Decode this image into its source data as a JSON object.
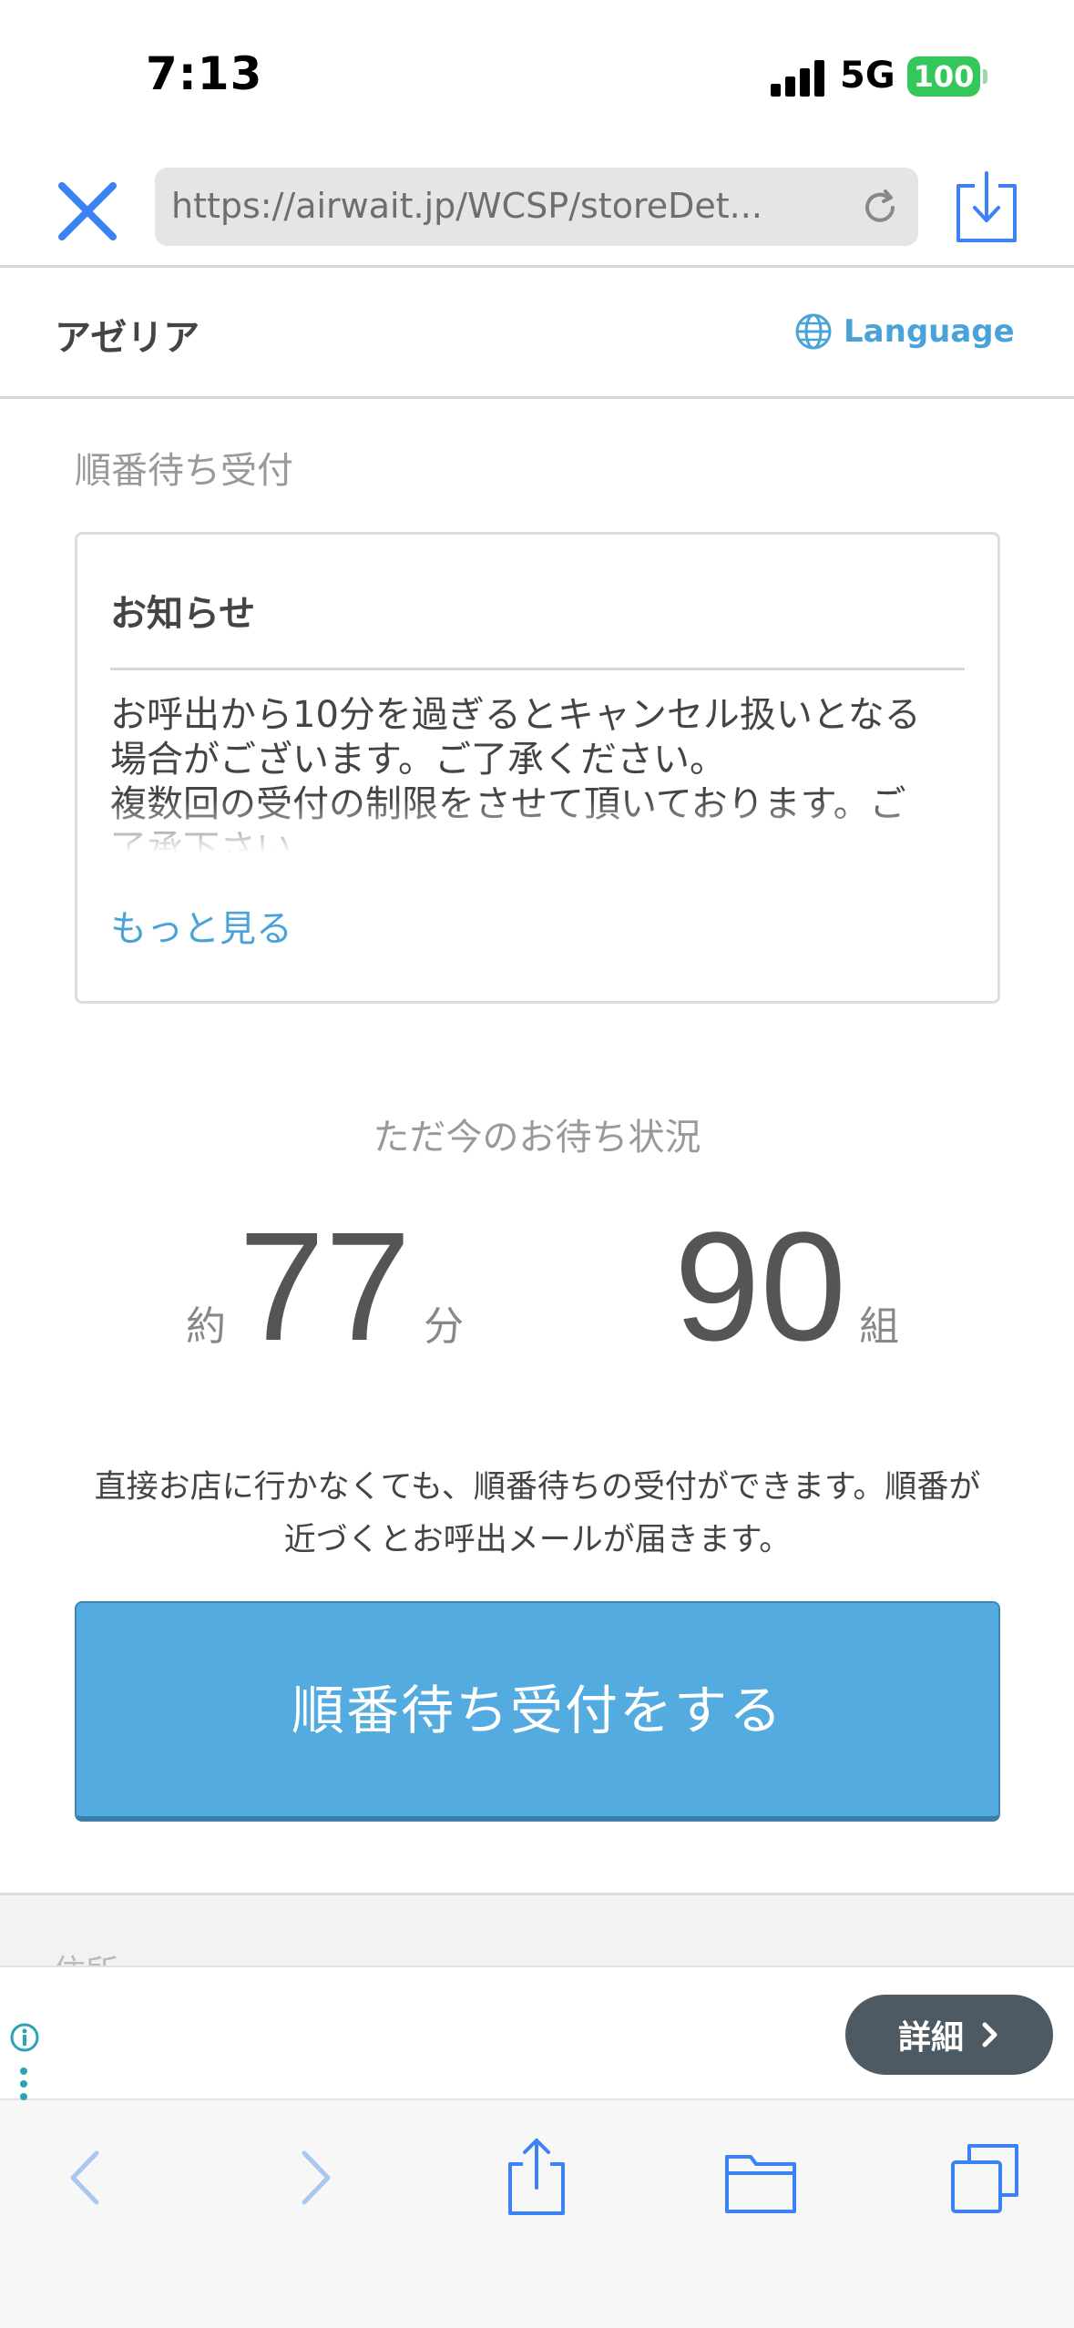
{
  "status_bar": {
    "time": "7:13",
    "network": "5G",
    "battery": "100",
    "battery_color": "#34c759"
  },
  "browser": {
    "url": "https://airwait.jp/WCSP/storeDet...",
    "icons": [
      "close-icon",
      "reload-icon",
      "download-icon"
    ],
    "accent": "#3b82f6"
  },
  "store": {
    "name": "アゼリア",
    "language_label": "Language",
    "language_icon": "globe-icon"
  },
  "reception": {
    "section_title": "順番待ち受付",
    "notice": {
      "title": "お知らせ",
      "body_lines": [
        "お呼出から10分を過ぎるとキャンセル扱いとなる",
        "場合がございます。ご了承ください。",
        "複数回の受付の制限をさせて頂いております。ご",
        "了承下さい。"
      ],
      "more_label": "もっと見る"
    },
    "wait_caption": "ただ今のお待ち状況",
    "wait_time": {
      "prefix": "約",
      "value": "77",
      "unit": "分"
    },
    "wait_groups": {
      "value": "90",
      "unit": "組"
    },
    "description_lines": [
      "直接お店に行かなくても、順番待ちの受付ができます。順番が",
      "近づくとお呼出メールが届きます。"
    ],
    "button_label": "順番待ち受付をする",
    "button_color": "#54abe0"
  },
  "next_section_label": "住所",
  "ad": {
    "detail_label": "詳細",
    "icons": [
      "info-icon",
      "more-dots-icon",
      "chevron-right-icon"
    ]
  },
  "toolbar": {
    "icons": [
      "back-icon",
      "forward-icon",
      "share-icon",
      "bookmarks-icon",
      "tabs-icon"
    ]
  }
}
